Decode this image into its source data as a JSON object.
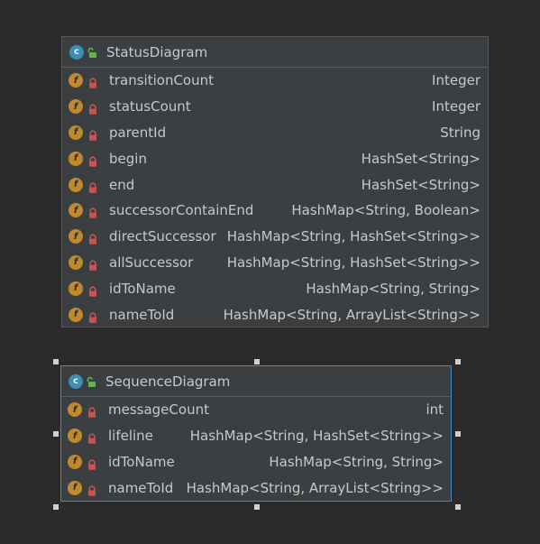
{
  "status_diagram": {
    "name": "StatusDiagram",
    "class_icon_letter": "c",
    "field_icon_letter": "f",
    "fields": [
      {
        "name": "transitionCount",
        "type": "Integer"
      },
      {
        "name": "statusCount",
        "type": "Integer"
      },
      {
        "name": "parentId",
        "type": "String"
      },
      {
        "name": "begin",
        "type": "HashSet<String>"
      },
      {
        "name": "end",
        "type": "HashSet<String>"
      },
      {
        "name": "successorContainEnd",
        "type": "HashMap<String, Boolean>"
      },
      {
        "name": "directSuccessor",
        "type": "HashMap<String, HashSet<String>>"
      },
      {
        "name": "allSuccessor",
        "type": "HashMap<String, HashSet<String>>"
      },
      {
        "name": "idToName",
        "type": "HashMap<String, String>"
      },
      {
        "name": "nameToId",
        "type": "HashMap<String, ArrayList<String>>"
      }
    ]
  },
  "sequence_diagram": {
    "name": "SequenceDiagram",
    "class_icon_letter": "c",
    "field_icon_letter": "f",
    "fields": [
      {
        "name": "messageCount",
        "type": "int"
      },
      {
        "name": "lifeline",
        "type": "HashMap<String, HashSet<String>>"
      },
      {
        "name": "idToName",
        "type": "HashMap<String, String>"
      },
      {
        "name": "nameToId",
        "type": "HashMap<String, ArrayList<String>>"
      }
    ]
  },
  "colors": {
    "background": "#2b2b2b",
    "box_fill": "#3c3f41",
    "class_icon": "#3b8fb5",
    "field_icon": "#c08a2c",
    "lock": "#c75450",
    "unlock": "#62b543",
    "selection_border": "#4a88c7",
    "text": "#c8c8c8"
  },
  "icons": {
    "class": "class-icon",
    "public_visibility": "unlock-icon",
    "field": "field-icon",
    "private_visibility": "lock-icon"
  }
}
